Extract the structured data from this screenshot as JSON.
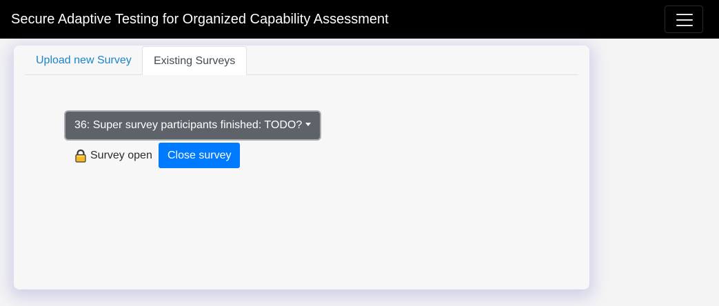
{
  "navbar": {
    "brand": "Secure Adaptive Testing for Organized Capability Assessment",
    "toggler_icon": "hamburger-menu-icon"
  },
  "tabs": [
    {
      "label": "Upload new Survey",
      "active": false
    },
    {
      "label": "Existing Surveys",
      "active": true
    }
  ],
  "survey_select": {
    "selected": "36: Super survey participants finished: TODO?",
    "icon": "caret-down-icon"
  },
  "survey_status": {
    "icon": "lock-icon",
    "label": "Survey open",
    "close_button": "Close survey"
  },
  "colors": {
    "navbar_bg": "#000000",
    "primary": "#007bff",
    "secondary": "#5d6369",
    "link": "#1a84c9"
  }
}
